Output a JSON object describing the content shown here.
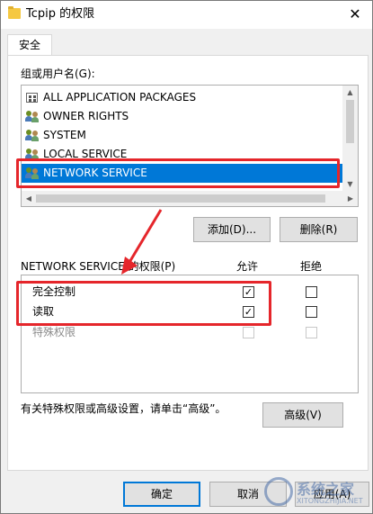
{
  "window": {
    "title": "Tcpip 的权限",
    "close_glyph": "✕"
  },
  "tabs": [
    {
      "label": "安全",
      "active": true
    }
  ],
  "group_list": {
    "label": "组或用户名(G):",
    "items": [
      {
        "label": "ALL APPLICATION PACKAGES",
        "icon": "package-icon"
      },
      {
        "label": "OWNER RIGHTS",
        "icon": "user-group-icon"
      },
      {
        "label": "SYSTEM",
        "icon": "user-group-icon"
      },
      {
        "label": "LOCAL SERVICE",
        "icon": "user-group-icon"
      },
      {
        "label": "NETWORK SERVICE",
        "icon": "user-group-icon",
        "selected": true
      }
    ]
  },
  "buttons": {
    "add": "添加(D)...",
    "remove": "删除(R)",
    "advanced": "高级(V)",
    "ok": "确定",
    "cancel": "取消",
    "apply": "应用(A)"
  },
  "permissions": {
    "header": "NETWORK SERVICE 的权限(P)",
    "allow_label": "允许",
    "deny_label": "拒绝",
    "rows": [
      {
        "name": "完全控制",
        "allow": true,
        "deny": false,
        "enabled": true
      },
      {
        "name": "读取",
        "allow": true,
        "deny": false,
        "enabled": true
      },
      {
        "name": "特殊权限",
        "allow": false,
        "deny": false,
        "enabled": false
      }
    ]
  },
  "advanced_hint": "有关特殊权限或高级设置，请单击“高级”。",
  "check_glyph": "✓",
  "watermark": {
    "text": "系统之家",
    "sub": "XITONGZHIJIA.NET"
  },
  "colors": {
    "selection": "#0078d7",
    "annotation": "#e5262b",
    "default_button_border": "#0078d7"
  }
}
